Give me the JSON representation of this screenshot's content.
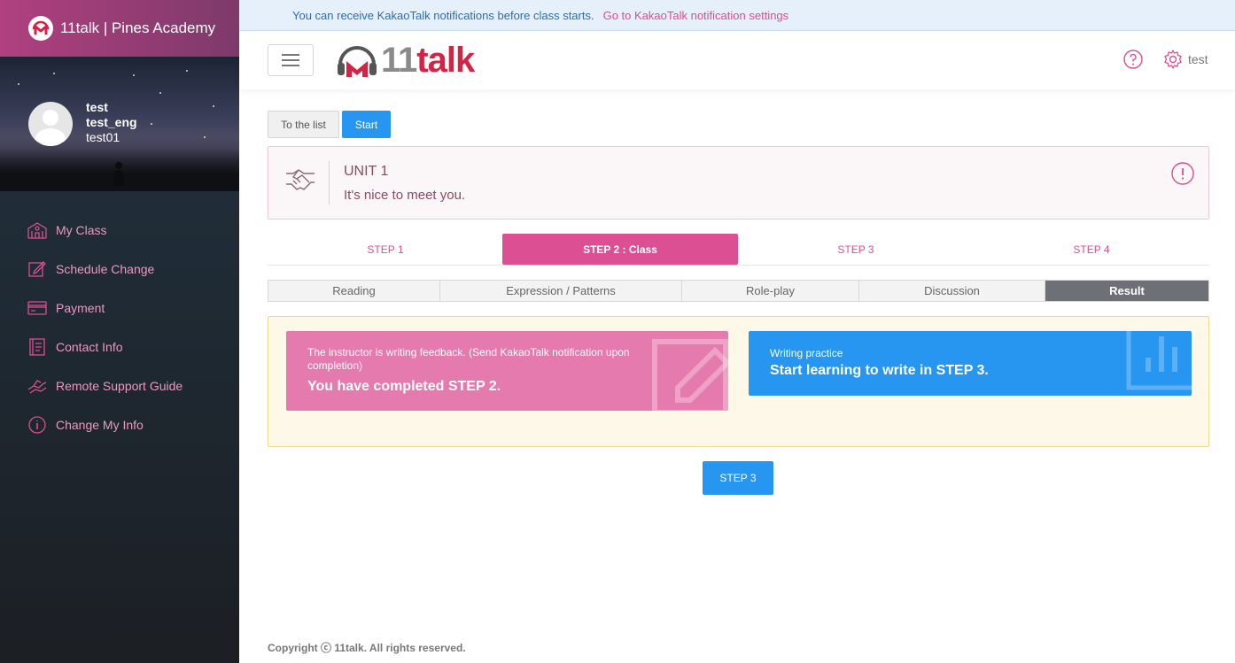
{
  "sidebar": {
    "brand": "11talk | Pines Academy",
    "profile": {
      "name": "test",
      "eng_name": "test_eng",
      "user_id": "test01"
    },
    "items": [
      {
        "label": "My Class",
        "icon": "school-icon"
      },
      {
        "label": "Schedule Change",
        "icon": "edit-icon"
      },
      {
        "label": "Payment",
        "icon": "card-icon"
      },
      {
        "label": "Contact Info",
        "icon": "contact-book-icon"
      },
      {
        "label": "Remote Support Guide",
        "icon": "support-hand-icon"
      },
      {
        "label": "Change My Info",
        "icon": "info-icon"
      }
    ]
  },
  "notice": {
    "message": "You can receive KakaoTalk notifications before class starts.",
    "link": "Go to KakaoTalk notification settings"
  },
  "header": {
    "logo_gray": "11",
    "logo_red": "talk",
    "user": "test"
  },
  "toolbar": {
    "list_label": "To the list",
    "start_label": "Start"
  },
  "unit": {
    "title": "UNIT 1",
    "subtitle": "It's nice to meet you."
  },
  "steps": [
    "STEP 1",
    "STEP 2 : Class",
    "STEP 3",
    "STEP 4"
  ],
  "subtabs": [
    "Reading",
    "Expression / Patterns",
    "Role-play",
    "Discussion",
    "Result"
  ],
  "result": {
    "pink_small": "The instructor is writing feedback. (Send KakaoTalk notification upon completion)",
    "pink_big": "You have completed STEP 2.",
    "blue_small": "Writing practice",
    "blue_big": "Start learning to write in STEP 3."
  },
  "next_button": "STEP 3",
  "footer": {
    "copyright": "Copyright ⓒ 11talk. All rights reserved."
  },
  "colors": {
    "accent_pink": "#dd4f93",
    "accent_blue": "#2796f0",
    "brand_red": "#d32346"
  }
}
